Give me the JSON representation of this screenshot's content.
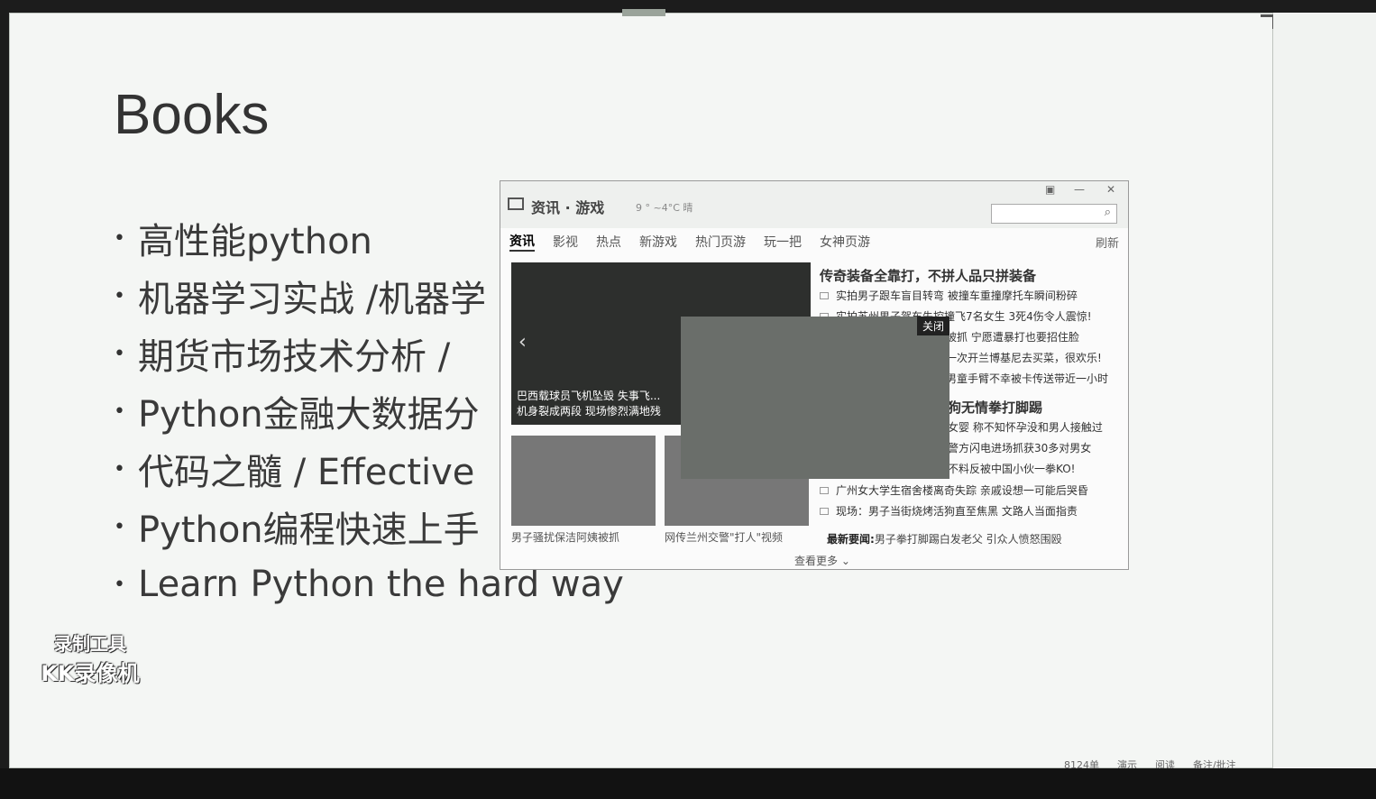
{
  "slide": {
    "title": "Books",
    "bullets": [
      "高性能python",
      "机器学习实战 /机器学",
      "期货市场技术分析 /",
      "Python金融大数据分",
      "代码之髓  / Effective",
      "Python编程快速上手",
      "Learn Python the hard way"
    ]
  },
  "watermark": {
    "line1": "录制工具",
    "line2": "KK录像机"
  },
  "popup": {
    "brand": "资讯 · 游戏",
    "weather": "9 ° ~4°C 晴",
    "search_placeholder": "",
    "tabs": [
      "资讯",
      "影视",
      "热点",
      "新游戏",
      "热门页游",
      "玩一把",
      "女神页游"
    ],
    "refresh": "刷新",
    "feature_caption_1": "巴西载球员飞机坠毁 失事飞...",
    "feature_caption_2": "机身裂成两段 现场惨烈满地残",
    "headline": "传奇装备全靠打，不拼人品只拼装备",
    "news": [
      "实拍男子跟车盲目转弯 被撞车重撞摩托车瞬间粉碎",
      "实拍苏州男子驾车失控撞飞7名女生 3死4伤令人震惊!",
      "被抓 宁愿遭暴打也要招住脸",
      "一次开兰博基尼去买菜，很欢乐!",
      "男童手臂不幸被卡传送带近一小时"
    ],
    "sub_headline": "狗无情拳打脚踢",
    "news2": [
      "女婴 称不知怀孕没和男人接触过",
      "警方闪电进场抓获30多对男女",
      "不料反被中国小伙一拳KO!"
    ],
    "news3": [
      "广州女大学生宿舍楼离奇失踪 亲戚设想一可能后哭昏",
      "现场：男子当街烧烤活狗直至焦黑 文路人当面指责"
    ],
    "thumb_caption_1": "男子骚扰保洁阿姨被抓",
    "thumb_caption_2": "网传兰州交警\"打人\"视频",
    "latest_label": "最新要闻:",
    "latest_text": "男子拳打脚踢白发老父 引众人愤怒围殴",
    "more": "查看更多",
    "ad_close": "关闭"
  },
  "status": [
    "8124单",
    "演示",
    "阅读",
    "备注/批注"
  ]
}
